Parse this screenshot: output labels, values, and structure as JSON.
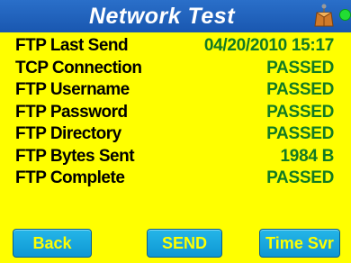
{
  "header": {
    "title": "Network Test",
    "icon": "network-icon",
    "status_color": "#22dd33"
  },
  "rows": [
    {
      "label": "FTP Last Send",
      "value": "04/20/2010 15:17"
    },
    {
      "label": "TCP Connection",
      "value": "PASSED"
    },
    {
      "label": "FTP Username",
      "value": "PASSED"
    },
    {
      "label": "FTP Password",
      "value": "PASSED"
    },
    {
      "label": "FTP Directory",
      "value": "PASSED"
    },
    {
      "label": "FTP Bytes Sent",
      "value": "1984 B"
    },
    {
      "label": "FTP Complete",
      "value": "PASSED"
    }
  ],
  "buttons": {
    "back": "Back",
    "send": "SEND",
    "time_svr": "Time Svr"
  },
  "colors": {
    "background": "#ffff00",
    "titlebar": "#1d5fbb",
    "value_text": "#127a22",
    "button": "#18a6df",
    "button_text": "#ffff00"
  }
}
